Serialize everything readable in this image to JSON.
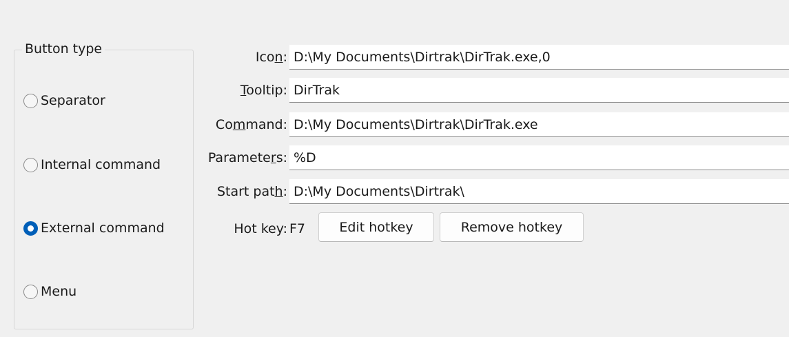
{
  "button_type_group": {
    "title": "Button type",
    "options": [
      {
        "label": "Separator",
        "checked": false
      },
      {
        "label": "Internal command",
        "checked": false
      },
      {
        "label": "External command",
        "checked": true
      },
      {
        "label": "Menu",
        "checked": false
      }
    ]
  },
  "fields": {
    "icon": {
      "label_before": "Ico",
      "label_access": "n",
      "label_after": ":",
      "value": "D:\\My Documents\\Dirtrak\\DirTrak.exe,0"
    },
    "tooltip": {
      "label_before": "",
      "label_access": "T",
      "label_after": "ooltip:",
      "value": "DirTrak"
    },
    "command": {
      "label_before": "Co",
      "label_access": "m",
      "label_after": "mand:",
      "value": "D:\\My Documents\\Dirtrak\\DirTrak.exe"
    },
    "parameters": {
      "label_before": "Paramete",
      "label_access": "r",
      "label_after": "s:",
      "value": "%D"
    },
    "start_path": {
      "label_before": "Start pat",
      "label_access": "h",
      "label_after": ":",
      "value": "D:\\My Documents\\Dirtrak\\"
    }
  },
  "hotkey": {
    "label": "Hot key:",
    "value": "F7",
    "edit_label": "Edit hotkey",
    "remove_label": "Remove hotkey"
  },
  "colors": {
    "background": "#f0f0f0",
    "accent": "#005fb8",
    "input_background": "#ffffff"
  }
}
